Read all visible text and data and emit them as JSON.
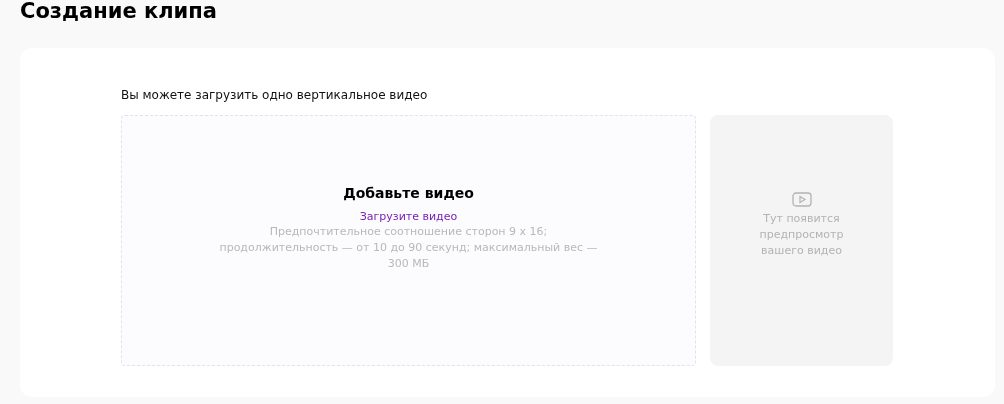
{
  "page_title": "Создание клипа",
  "upload": {
    "hint": "Вы можете загрузить одно вертикальное видео",
    "dropzone": {
      "title": "Добавьте видео",
      "link": "Загрузите видео",
      "requirements": "Предпочтительное соотношение сторон 9 х 16; продолжительность — от 10 до 90 секунд; максимальный вес — 300 МБ"
    },
    "preview": {
      "text": "Тут появится предпросмотр вашего видео"
    }
  }
}
